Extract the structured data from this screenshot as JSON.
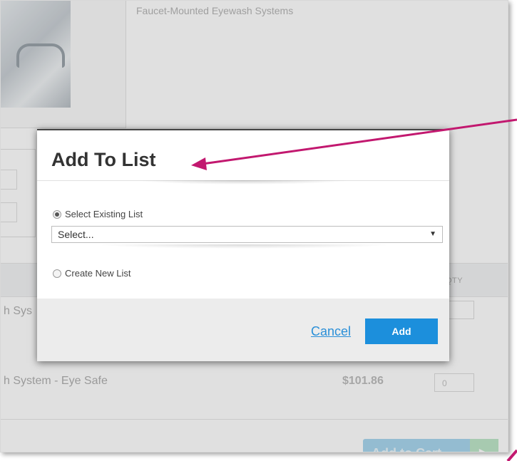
{
  "background": {
    "product_subtitle": "Faucet-Mounted Eyewash Systems",
    "table": {
      "qty_header": "QTY",
      "rows": [
        {
          "name": "h Sys",
          "price": "",
          "qty": ""
        },
        {
          "name": "h System - Eye Safe",
          "price": "$101.86",
          "qty": "0"
        }
      ]
    },
    "add_to_cart_label": "Add to Cart",
    "add_to_cart_icon": "play-arrow-icon"
  },
  "modal": {
    "title": "Add To List",
    "option_existing_label": "Select Existing List",
    "option_existing_selected": true,
    "select_value": "Select...",
    "option_new_label": "Create New List",
    "cancel_label": "Cancel",
    "add_label": "Add"
  },
  "colors": {
    "primary_blue": "#1c8fdc",
    "link_blue": "#2a8fd8",
    "annotation_magenta": "#c2186f"
  }
}
